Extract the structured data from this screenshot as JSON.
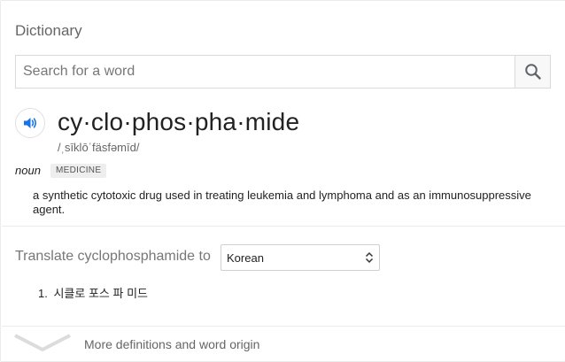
{
  "panel": {
    "title": "Dictionary"
  },
  "search": {
    "placeholder": "Search for a word",
    "value": ""
  },
  "entry": {
    "headword": "cy·clo·phos·pha·mide",
    "pronunciation": "/ˌsīklōˈfäsfəmīd/",
    "part_of_speech": "noun",
    "category_badge": "MEDICINE",
    "definition": "a synthetic cytotoxic drug used in treating leukemia and lymphoma and as an immunosuppressive agent."
  },
  "translate": {
    "label": "Translate cyclophosphamide to",
    "selected_language": "Korean",
    "results": [
      {
        "number": "1.",
        "text": "시클로 포스 파 미드"
      }
    ]
  },
  "footer": {
    "more_label": "More definitions and word origin"
  },
  "colors": {
    "accent_blue": "#1a73e8",
    "muted_text": "#666666",
    "divider": "#ebebeb"
  },
  "icons": {
    "search": "search-icon",
    "speaker": "speaker-icon",
    "select_arrows": "select-arrows-icon",
    "expand": "chevron-down-icon"
  }
}
